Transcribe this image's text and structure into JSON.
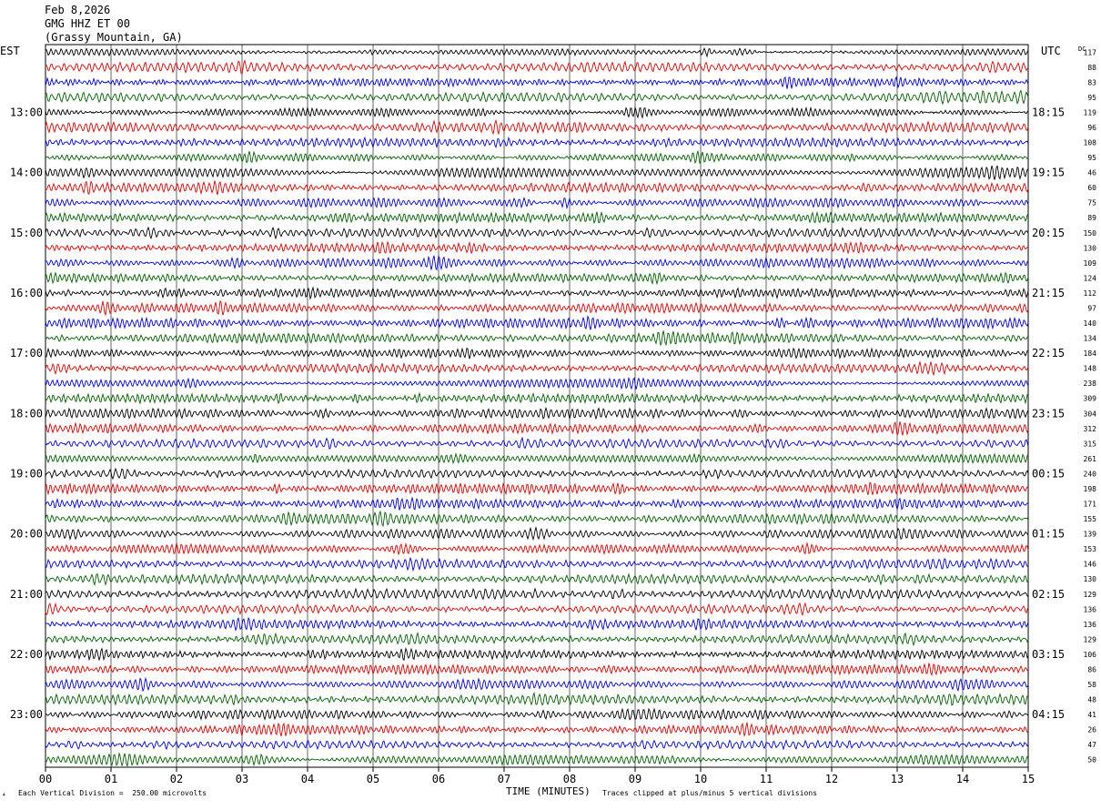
{
  "header": {
    "date": "Feb 8,2026",
    "station": "GMG HHZ ET 00",
    "location": "(Grassy Mountain, GA)",
    "left_zone": "EST",
    "right_zone": "UTC",
    "dc_label": "DC"
  },
  "footer": {
    "scale_note": "Each Vertical Division =  250.00 microvolts",
    "xlabel": "TIME (MINUTES)",
    "clip_note": "Traces clipped at plus/minus 5 vertical divisions"
  },
  "chart_data": {
    "type": "line",
    "title": "GMG HHZ ET 00",
    "xlabel": "TIME (MINUTES)",
    "xlim": [
      0,
      15
    ],
    "x_ticks": [
      "00",
      "01",
      "02",
      "03",
      "04",
      "05",
      "06",
      "07",
      "08",
      "09",
      "10",
      "11",
      "12",
      "13",
      "14",
      "15"
    ],
    "trace_colors": [
      "#000000",
      "#e00000",
      "#0000e0",
      "#006000"
    ],
    "trace_count": 48,
    "left_hour_labels": [
      "13:00",
      "14:00",
      "15:00",
      "16:00",
      "17:00",
      "18:00",
      "19:00",
      "20:00",
      "21:00",
      "22:00",
      "23:00"
    ],
    "right_hour_labels": [
      "18:15",
      "19:15",
      "20:15",
      "21:15",
      "22:15",
      "23:15",
      "00:15",
      "01:15",
      "02:15",
      "03:15",
      "04:15"
    ],
    "dc_offsets": [
      117,
      88,
      83,
      95,
      119,
      96,
      108,
      95,
      46,
      60,
      75,
      89,
      150,
      130,
      109,
      124,
      112,
      97,
      140,
      134,
      184,
      148,
      238,
      309,
      304,
      312,
      315,
      261,
      240,
      198,
      171,
      155,
      139,
      153,
      146,
      130,
      129,
      136,
      136,
      129,
      106,
      86,
      58,
      48,
      41,
      26,
      47,
      50
    ],
    "grid": true
  }
}
